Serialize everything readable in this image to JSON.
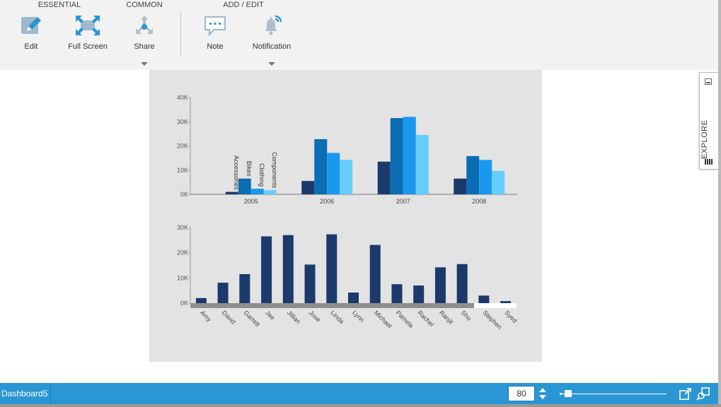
{
  "ribbon": {
    "groups": {
      "essential": "ESSENTIAL",
      "common": "COMMON",
      "add_edit": "ADD / EDIT"
    },
    "buttons": {
      "edit": "Edit",
      "full_screen": "Full Screen",
      "share": "Share",
      "note": "Note",
      "notification": "Notification"
    },
    "icons": [
      "edit-icon",
      "full-screen-icon",
      "share-icon",
      "note-icon",
      "notification-icon"
    ],
    "icon_color": "#2a96d4"
  },
  "explore_panel": {
    "label": "EXPLORE"
  },
  "status_bar": {
    "dashboard_name": "Dashboard5",
    "zoom": "80",
    "zoom_fraction": 0.06,
    "color": "#2a96d4"
  },
  "chart_data": [
    {
      "type": "bar",
      "categories": [
        "2005",
        "2006",
        "2007",
        "2008"
      ],
      "series": [
        {
          "name": "Accessories",
          "values": [
            1000,
            5500,
            13500,
            6500
          ]
        },
        {
          "name": "Bikes",
          "values": [
            6500,
            22800,
            31500,
            15800
          ]
        },
        {
          "name": "Clothing",
          "values": [
            2300,
            17100,
            32000,
            14200
          ]
        },
        {
          "name": "Components",
          "values": [
            1700,
            14200,
            24500,
            9700
          ]
        }
      ],
      "colors": [
        "#1b3a6b",
        "#0b6db3",
        "#1a98f0",
        "#66cdff"
      ],
      "yticks": [
        "0K",
        "10K",
        "20K",
        "30K",
        "40K"
      ],
      "ylim": [
        0,
        40000
      ],
      "series_labels_on_first_category": true
    },
    {
      "type": "bar",
      "categories": [
        "Amy",
        "David",
        "Garrett",
        "Jae",
        "Jillian",
        "José",
        "Linda",
        "Lynn",
        "Michael",
        "Pamela",
        "Rachel",
        "Ranjit",
        "Shu",
        "Stephen",
        "Syed"
      ],
      "values": [
        2000,
        8100,
        11500,
        26500,
        27000,
        15300,
        27300,
        4200,
        23100,
        7500,
        7000,
        14200,
        15500,
        3000,
        800
      ],
      "color": "#1b3a6b",
      "yticks": [
        "0K",
        "10K",
        "20K",
        "30K"
      ],
      "ylim": [
        0,
        30000
      ],
      "scrollbar_fraction": 0.87
    }
  ]
}
